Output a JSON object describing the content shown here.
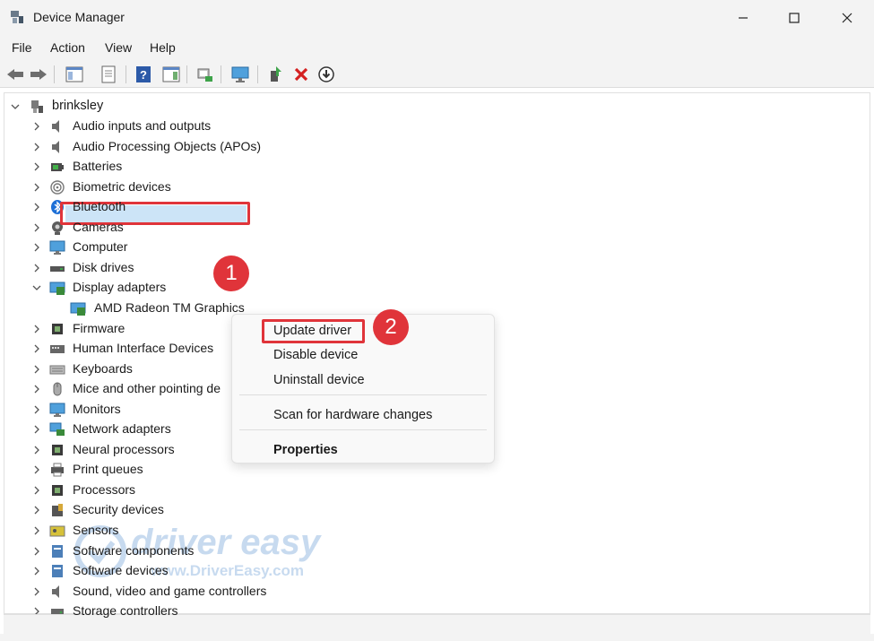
{
  "window": {
    "title": "Device Manager"
  },
  "menu": [
    "File",
    "Action",
    "View",
    "Help"
  ],
  "tree": {
    "root": "brinksley",
    "categories": [
      {
        "label": "Audio inputs and outputs",
        "icon": "speaker-icon"
      },
      {
        "label": "Audio Processing Objects (APOs)",
        "icon": "speaker-icon"
      },
      {
        "label": "Batteries",
        "icon": "battery-icon"
      },
      {
        "label": "Biometric devices",
        "icon": "fingerprint-icon"
      },
      {
        "label": "Bluetooth",
        "icon": "bluetooth-icon"
      },
      {
        "label": "Cameras",
        "icon": "camera-icon"
      },
      {
        "label": "Computer",
        "icon": "monitor-icon"
      },
      {
        "label": "Disk drives",
        "icon": "disk-icon"
      },
      {
        "label": "Display adapters",
        "icon": "display-adapter-icon"
      },
      {
        "label": "AMD Radeon TM Graphics",
        "icon": "display-adapter-icon"
      },
      {
        "label": "Firmware",
        "icon": "chip-icon"
      },
      {
        "label": "Human Interface Devices",
        "icon": "hid-icon"
      },
      {
        "label": "Keyboards",
        "icon": "keyboard-icon"
      },
      {
        "label": "Mice and other pointing de",
        "icon": "mouse-icon"
      },
      {
        "label": "Monitors",
        "icon": "monitor-icon"
      },
      {
        "label": "Network adapters",
        "icon": "network-icon"
      },
      {
        "label": "Neural processors",
        "icon": "chip-icon"
      },
      {
        "label": "Print queues",
        "icon": "printer-icon"
      },
      {
        "label": "Processors",
        "icon": "chip-icon"
      },
      {
        "label": "Security devices",
        "icon": "security-icon"
      },
      {
        "label": "Sensors",
        "icon": "sensor-icon"
      },
      {
        "label": "Software components",
        "icon": "software-icon"
      },
      {
        "label": "Software devices",
        "icon": "software-icon"
      },
      {
        "label": "Sound, video and game controllers",
        "icon": "speaker-icon"
      },
      {
        "label": "Storage controllers",
        "icon": "storage-icon"
      }
    ]
  },
  "context_menu": {
    "update": "Update driver",
    "disable": "Disable device",
    "uninstall": "Uninstall device",
    "scan": "Scan for hardware changes",
    "properties": "Properties"
  },
  "annotations": {
    "step1": "1",
    "step2": "2"
  },
  "watermark": {
    "brand": "driver easy",
    "url": "www.DriverEasy.com"
  },
  "colors": {
    "highlight_red": "#e0343a",
    "selection_blue": "#cce4f7",
    "chrome": "#f3f3f3"
  }
}
